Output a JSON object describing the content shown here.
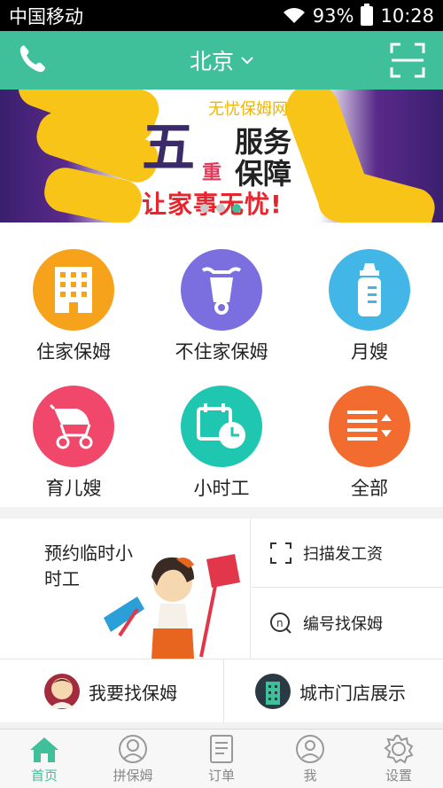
{
  "status_bar": {
    "carrier": "中国移动",
    "battery": "93%",
    "time": "10:28"
  },
  "header": {
    "city": "北京"
  },
  "banner": {
    "subtitle": "无忧保姆网",
    "big_char": "五",
    "small_char": "重",
    "service": "服务",
    "protect": "保障",
    "slogan": "让家事无忧!",
    "dot_count": 3,
    "active_dot": 2
  },
  "categories": [
    {
      "label": "住家保姆",
      "icon": "building-icon",
      "color": "#f7a21b"
    },
    {
      "label": "不住家保姆",
      "icon": "scooter-icon",
      "color": "#7b6fe0"
    },
    {
      "label": "月嫂",
      "icon": "baby-bottle-icon",
      "color": "#42b6e6"
    },
    {
      "label": "育儿嫂",
      "icon": "stroller-icon",
      "color": "#f0476b"
    },
    {
      "label": "小时工",
      "icon": "calendar-clock-icon",
      "color": "#1fc7b1"
    },
    {
      "label": "全部",
      "icon": "list-sort-icon",
      "color": "#f26b2f"
    }
  ],
  "services": {
    "promo_text": "预约临时小时工",
    "scan_salary": "扫描发工资",
    "find_by_number": "编号找保姆"
  },
  "links": {
    "find_nanny": "我要找保姆",
    "city_stores": "城市门店展示"
  },
  "tabs": [
    {
      "label": "首页",
      "icon": "home-icon",
      "active": true
    },
    {
      "label": "拼保姆",
      "icon": "user-outline-icon",
      "active": false
    },
    {
      "label": "订单",
      "icon": "document-icon",
      "active": false
    },
    {
      "label": "我",
      "icon": "person-circle-icon",
      "active": false
    },
    {
      "label": "设置",
      "icon": "gear-icon",
      "active": false
    }
  ],
  "colors": {
    "accent": "#3fbf9a",
    "banner_yellow": "#f8c418",
    "slogan_red": "#e8242c"
  }
}
